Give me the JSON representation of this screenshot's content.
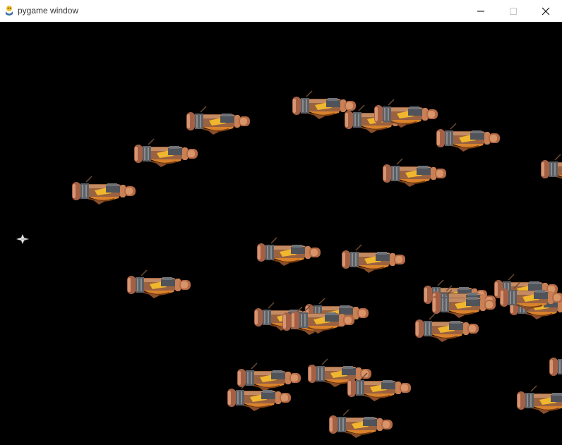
{
  "window": {
    "title": "pygame window",
    "icon": "pygame-snake-icon"
  },
  "controls": {
    "minimize_icon": "minimize-icon",
    "maximize_icon": "maximize-icon",
    "close_icon": "close-icon"
  },
  "game": {
    "background": "#000000",
    "player_sprite": "white-fighter-ship",
    "enemy_sprite": "brown-gunship",
    "enemy_count": 30
  }
}
